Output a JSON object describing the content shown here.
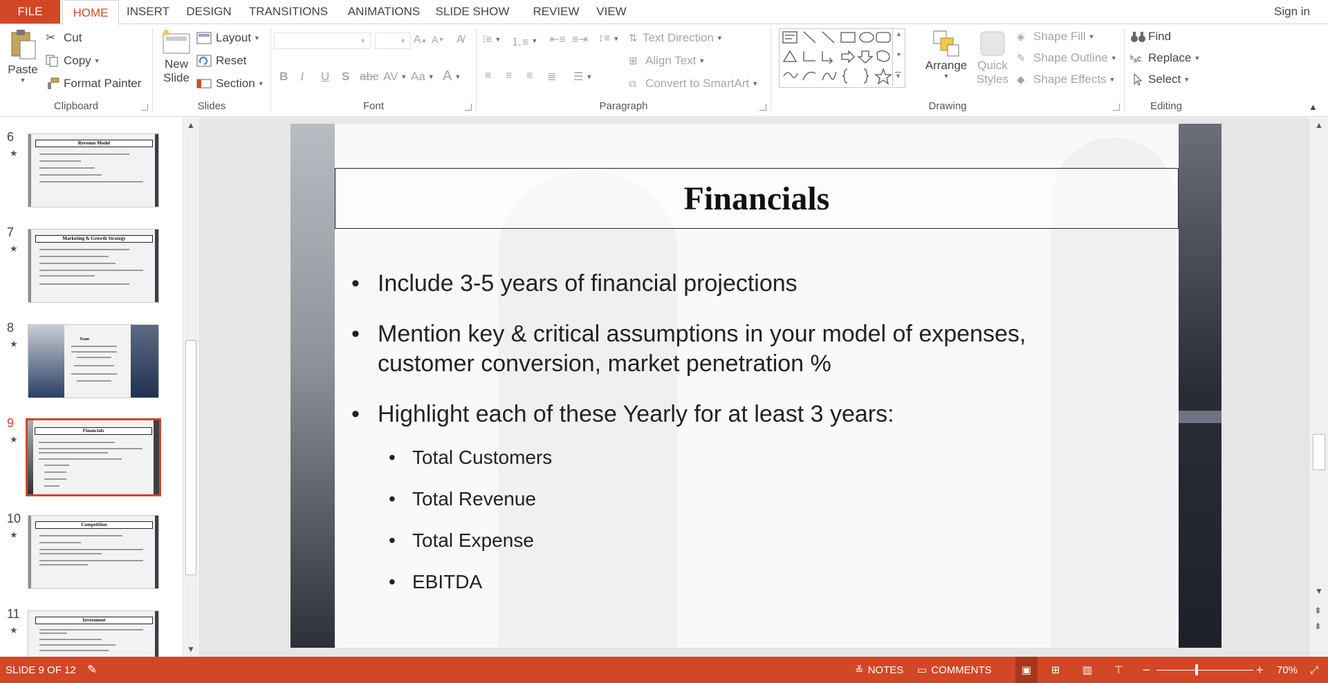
{
  "tabs": {
    "file": "FILE",
    "items": [
      "HOME",
      "INSERT",
      "DESIGN",
      "TRANSITIONS",
      "ANIMATIONS",
      "SLIDE SHOW",
      "REVIEW",
      "VIEW"
    ],
    "active": "HOME",
    "sign_in": "Sign in"
  },
  "ribbon": {
    "clipboard": {
      "paste": "Paste",
      "cut": "Cut",
      "copy": "Copy",
      "format_painter": "Format Painter",
      "label": "Clipboard"
    },
    "slides": {
      "new_slide_1": "New",
      "new_slide_2": "Slide",
      "layout": "Layout",
      "reset": "Reset",
      "section": "Section",
      "label": "Slides"
    },
    "font": {
      "label": "Font",
      "bold": "B",
      "italic": "I",
      "underline": "U",
      "shadow": "S",
      "strike": "abc",
      "spacing": "AV",
      "case": "Aa",
      "color": "A"
    },
    "paragraph": {
      "label": "Paragraph",
      "text_direction": "Text Direction",
      "align_text": "Align Text",
      "convert_smartart": "Convert to SmartArt"
    },
    "drawing": {
      "label": "Drawing",
      "arrange": "Arrange",
      "quick_styles_1": "Quick",
      "quick_styles_2": "Styles",
      "shape_fill": "Shape Fill",
      "shape_outline": "Shape Outline",
      "shape_effects": "Shape Effects"
    },
    "editing": {
      "label": "Editing",
      "find": "Find",
      "replace": "Replace",
      "select": "Select"
    }
  },
  "thumbnails": [
    {
      "num": "6",
      "title": "Revenue Model"
    },
    {
      "num": "7",
      "title": "Marketing & Growth Strategy"
    },
    {
      "num": "8",
      "title": "Team"
    },
    {
      "num": "9",
      "title": "Financials"
    },
    {
      "num": "10",
      "title": "Competition"
    },
    {
      "num": "11",
      "title": "Investment"
    }
  ],
  "slide": {
    "title": "Financials",
    "bullets": [
      "Include 3-5 years of financial projections",
      "Mention key & critical assumptions in your model of expenses,",
      "customer conversion, market penetration %",
      "Highlight each of these Yearly for at least 3 years:"
    ],
    "sub_bullets": [
      "Total Customers",
      "Total Revenue",
      "Total Expense",
      "EBITDA"
    ],
    "bullet_glyph": "•"
  },
  "status": {
    "slide_info": "SLIDE 9 OF 12",
    "notes": "NOTES",
    "comments": "COMMENTS",
    "zoom": "70%"
  },
  "colors": {
    "accent": "#d24726"
  }
}
